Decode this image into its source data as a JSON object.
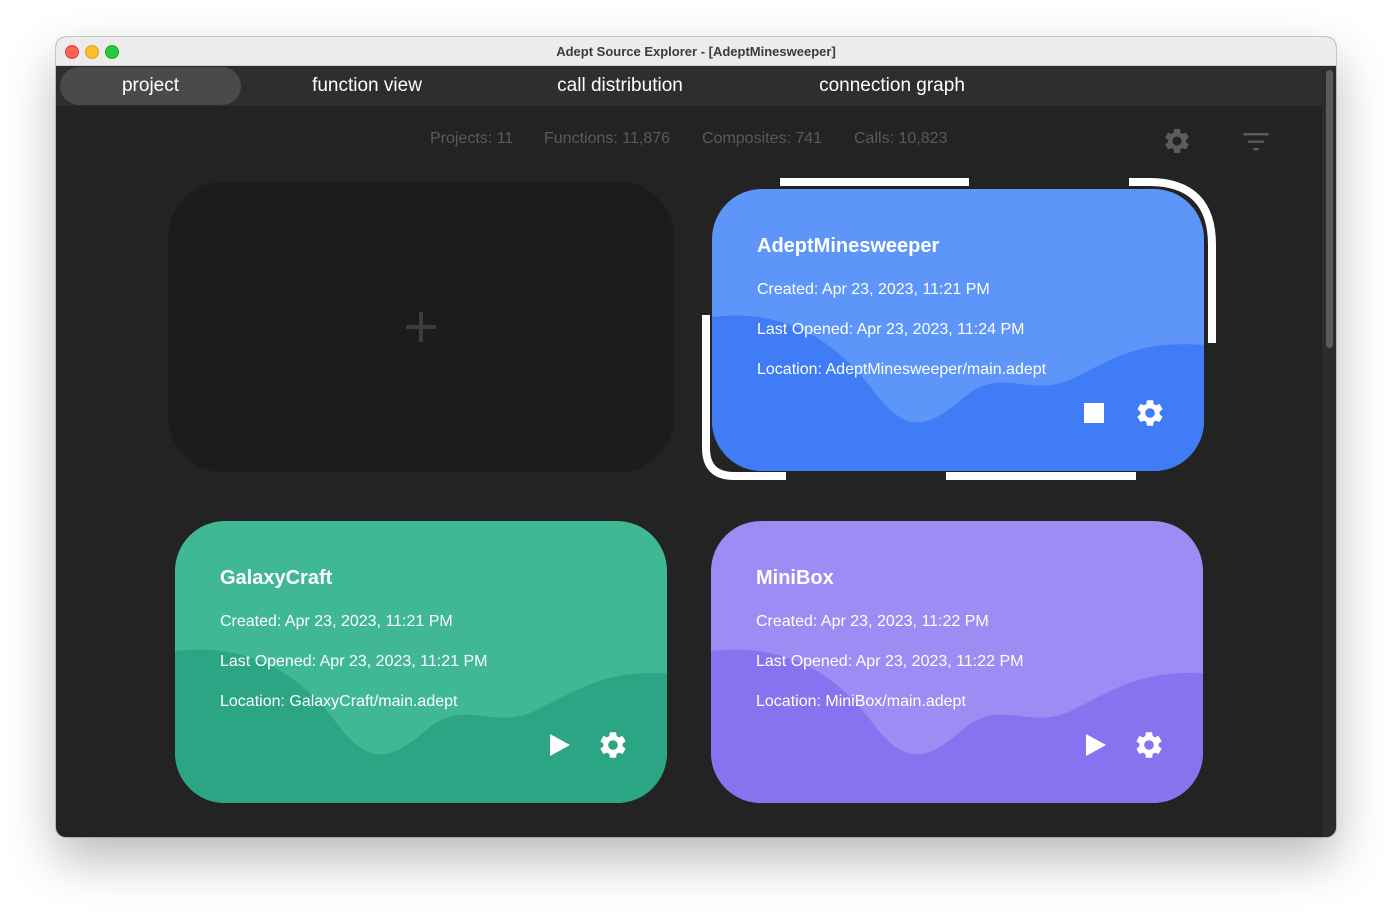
{
  "window": {
    "title": "Adept Source Explorer - [AdeptMinesweeper]"
  },
  "tabs": [
    {
      "label": "project",
      "active": true
    },
    {
      "label": "function view",
      "active": false
    },
    {
      "label": "call distribution",
      "active": false
    },
    {
      "label": "connection graph",
      "active": false
    }
  ],
  "stats": {
    "projects": "Projects: 11",
    "functions": "Functions: 11,876",
    "composites": "Composites: 741",
    "calls": "Calls: 10,823"
  },
  "toolbar": {
    "settings_icon": "gear-icon",
    "filter_icon": "filter-icon"
  },
  "new_project": {
    "icon": "plus-icon"
  },
  "projects": [
    {
      "name": "AdeptMinesweeper",
      "created": "Created: Apr 23, 2023, 11:21 PM",
      "last_opened": "Last Opened: Apr 23, 2023, 11:24 PM",
      "location": "Location: AdeptMinesweeper/main.adept",
      "state": "running",
      "action_icon": "stop-icon",
      "settings_icon": "gear-icon",
      "selected": true,
      "colors": {
        "light": "#5e95f8",
        "dark": "#3f7cf6"
      }
    },
    {
      "name": "GalaxyCraft",
      "created": "Created: Apr 23, 2023, 11:21 PM",
      "last_opened": "Last Opened: Apr 23, 2023, 11:21 PM",
      "location": "Location: GalaxyCraft/main.adept",
      "state": "stopped",
      "action_icon": "play-icon",
      "settings_icon": "gear-icon",
      "selected": false,
      "colors": {
        "light": "#40b896",
        "dark": "#2ba584"
      }
    },
    {
      "name": "MiniBox",
      "created": "Created: Apr 23, 2023, 11:22 PM",
      "last_opened": "Last Opened: Apr 23, 2023, 11:22 PM",
      "location": "Location: MiniBox/main.adept",
      "state": "stopped",
      "action_icon": "play-icon",
      "settings_icon": "gear-icon",
      "selected": false,
      "colors": {
        "light": "#9d8cf3",
        "dark": "#8872ef"
      }
    }
  ]
}
